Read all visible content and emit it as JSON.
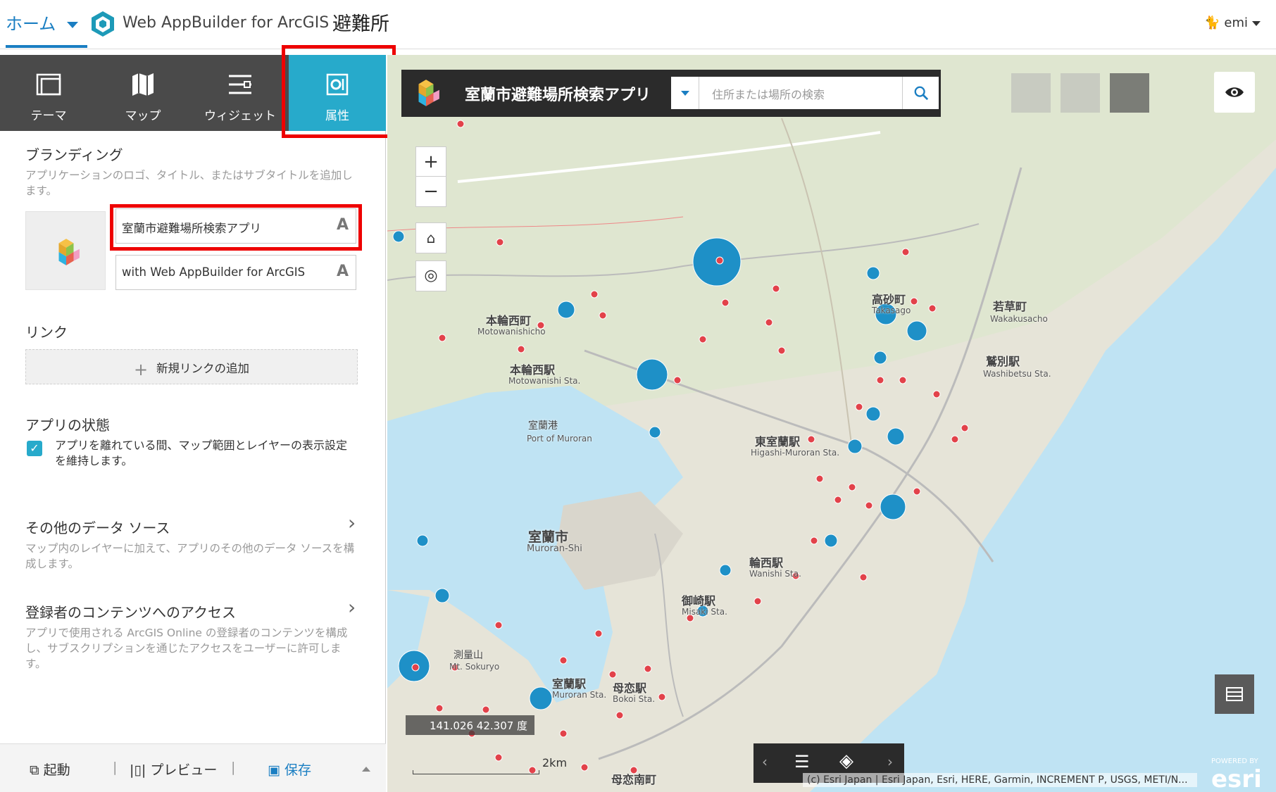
{
  "topbar": {
    "home_label": "ホーム",
    "product_title": "Web AppBuilder for ArcGIS",
    "app_name": "避難所",
    "user": "emi"
  },
  "panel": {
    "tabs": [
      {
        "label": "テーマ",
        "icon": "theme-icon"
      },
      {
        "label": "マップ",
        "icon": "map-icon"
      },
      {
        "label": "ウィジェット",
        "icon": "widget-icon"
      },
      {
        "label": "属性",
        "icon": "attribute-icon",
        "active": true
      }
    ],
    "branding": {
      "title": "ブランディング",
      "desc": "アプリケーションのロゴ、タイトル、またはサブタイトルを追加します。",
      "title_value": "室蘭市避難場所検索アプリ",
      "subtitle_value": "with Web AppBuilder for ArcGIS"
    },
    "links": {
      "title": "リンク",
      "add_label": "新規リンクの追加"
    },
    "app_state": {
      "title": "アプリの状態",
      "checkbox_label": "アプリを離れている間、マップ範囲とレイヤーの表示設定を維持します。",
      "checked": true
    },
    "data_sources": {
      "title": "その他のデータ ソース",
      "desc": "マップ内のレイヤーに加えて、アプリのその他のデータ ソースを構成します。"
    },
    "subscriber": {
      "title": "登録者のコンテンツへのアクセス",
      "desc": "アプリで使用される ArcGIS Online の登録者のコンテンツを構成し、サブスクリプションを通じたアクセスをユーザーに許可します。"
    },
    "bottom": {
      "launch": "起動",
      "preview": "プレビュー",
      "save": "保存"
    }
  },
  "map": {
    "header_title": "室蘭市避難場所検索アプリ",
    "search_placeholder": "住所または場所の検索",
    "coords": "141.026 42.307 度",
    "scale": "2km",
    "attribution": "(c) Esri Japan | Esri Japan, Esri, HERE, Garmin, INCREMENT P, USGS, METI/N...",
    "esri_powered": "POWERED BY",
    "esri_label": "esri",
    "labels": [
      {
        "text": "室蘭市",
        "sub": "Muroran-Shi"
      },
      {
        "text": "本輪西町",
        "sub": "Motowanishicho"
      },
      {
        "text": "本輪西駅",
        "sub": "Motowanishi Sta."
      },
      {
        "text": "東室蘭駅",
        "sub": "Higashi-Muroran Sta."
      },
      {
        "text": "輪西駅",
        "sub": "Wanishi Sta."
      },
      {
        "text": "御崎駅",
        "sub": "Misaki Sta."
      },
      {
        "text": "母恋駅",
        "sub": "Bokoi Sta."
      },
      {
        "text": "室蘭駅",
        "sub": "Muroran Sta."
      },
      {
        "text": "鷲別駅",
        "sub": "Washibetsu Sta."
      },
      {
        "text": "若草町",
        "sub": "Wakakusacho"
      },
      {
        "text": "室蘭港",
        "sub": "Port of Muroran"
      },
      {
        "text": "高砂町",
        "sub": "Takasago"
      },
      {
        "text": "母恋南町",
        "sub": ""
      },
      {
        "text": "測量山",
        "sub": "Mt. Sokuryo"
      }
    ]
  }
}
